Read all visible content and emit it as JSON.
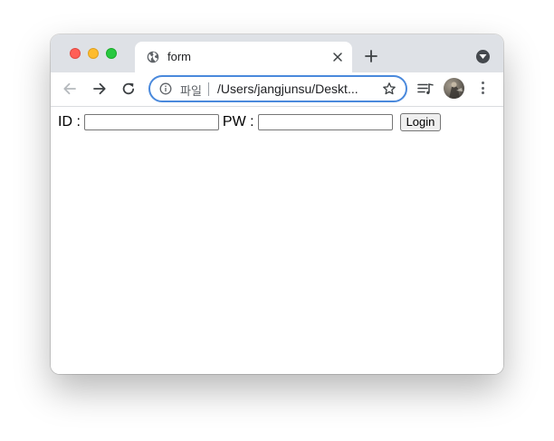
{
  "tab": {
    "title": "form"
  },
  "omnibox": {
    "scheme_label": "파일",
    "url": "/Users/jangjunsu/Deskt..."
  },
  "form": {
    "id_label": "ID :",
    "id_value": "",
    "pw_label": "PW :",
    "pw_value": "",
    "login_label": "Login"
  },
  "colors": {
    "tabstrip": "#dee1e6",
    "omnibox_border": "#4a89dc",
    "traffic_close": "#ff5f57",
    "traffic_min": "#febc2e",
    "traffic_max": "#28c840"
  }
}
